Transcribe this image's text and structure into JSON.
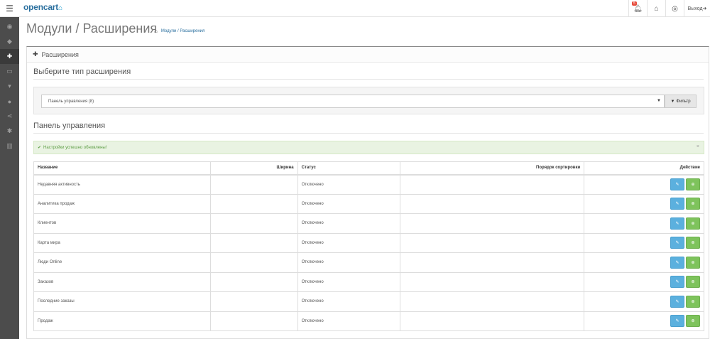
{
  "header": {
    "logo_text": "opencart",
    "logo_cart": "🛒",
    "alerts_count": "5",
    "logout_label": "Выход"
  },
  "sidebar": {
    "items": [
      {
        "icon": "dashboard-icon",
        "glyph": "◉",
        "active": false
      },
      {
        "icon": "tag-icon",
        "glyph": "◆",
        "active": false
      },
      {
        "icon": "puzzle-icon",
        "glyph": "✚",
        "active": true
      },
      {
        "icon": "monitor-icon",
        "glyph": "▭",
        "active": false
      },
      {
        "icon": "cart-icon",
        "glyph": "▾",
        "active": false
      },
      {
        "icon": "user-icon",
        "glyph": "●",
        "active": false
      },
      {
        "icon": "share-icon",
        "glyph": "⋖",
        "active": false
      },
      {
        "icon": "gear-icon",
        "glyph": "✱",
        "active": false
      },
      {
        "icon": "bar-chart-icon",
        "glyph": "▥",
        "active": false
      }
    ]
  },
  "page": {
    "title": "Модули / Расширения",
    "breadcrumb": [
      "Модули / Расширения"
    ]
  },
  "panel": {
    "heading": "Расширения",
    "choose_type_heading": "Выберите тип расширения",
    "selected_type": "Панель управления (8)",
    "filter_label": "Фильтр",
    "section_heading": "Панель управления",
    "success_message": "Настройки успешно обновлены!",
    "close_glyph": "×"
  },
  "table": {
    "headers": {
      "name": "Название",
      "width": "Ширина",
      "status": "Статус",
      "sort_order": "Порядок сортировки",
      "action": "Действие"
    },
    "rows": [
      {
        "name": "Недавняя активность",
        "width": "",
        "status": "Отключено",
        "sort_order": ""
      },
      {
        "name": "Аналитика продаж",
        "width": "",
        "status": "Отключено",
        "sort_order": ""
      },
      {
        "name": " Клиентов",
        "width": "",
        "status": "Отключено",
        "sort_order": ""
      },
      {
        "name": "Карта мира",
        "width": "",
        "status": "Отключено",
        "sort_order": ""
      },
      {
        "name": "Люди Online",
        "width": "",
        "status": "Отключено",
        "sort_order": ""
      },
      {
        "name": "Заказов",
        "width": "",
        "status": "Отключено",
        "sort_order": ""
      },
      {
        "name": "Последние заказы",
        "width": "",
        "status": "Отключено",
        "sort_order": ""
      },
      {
        "name": "Продаж",
        "width": "",
        "status": "Отключено",
        "sort_order": ""
      }
    ]
  },
  "colors": {
    "sidebar_bg": "#4c4c4c",
    "edit_button": "#5bb0de",
    "install_button": "#7ec35c",
    "success_bg": "#e9f3e2"
  }
}
